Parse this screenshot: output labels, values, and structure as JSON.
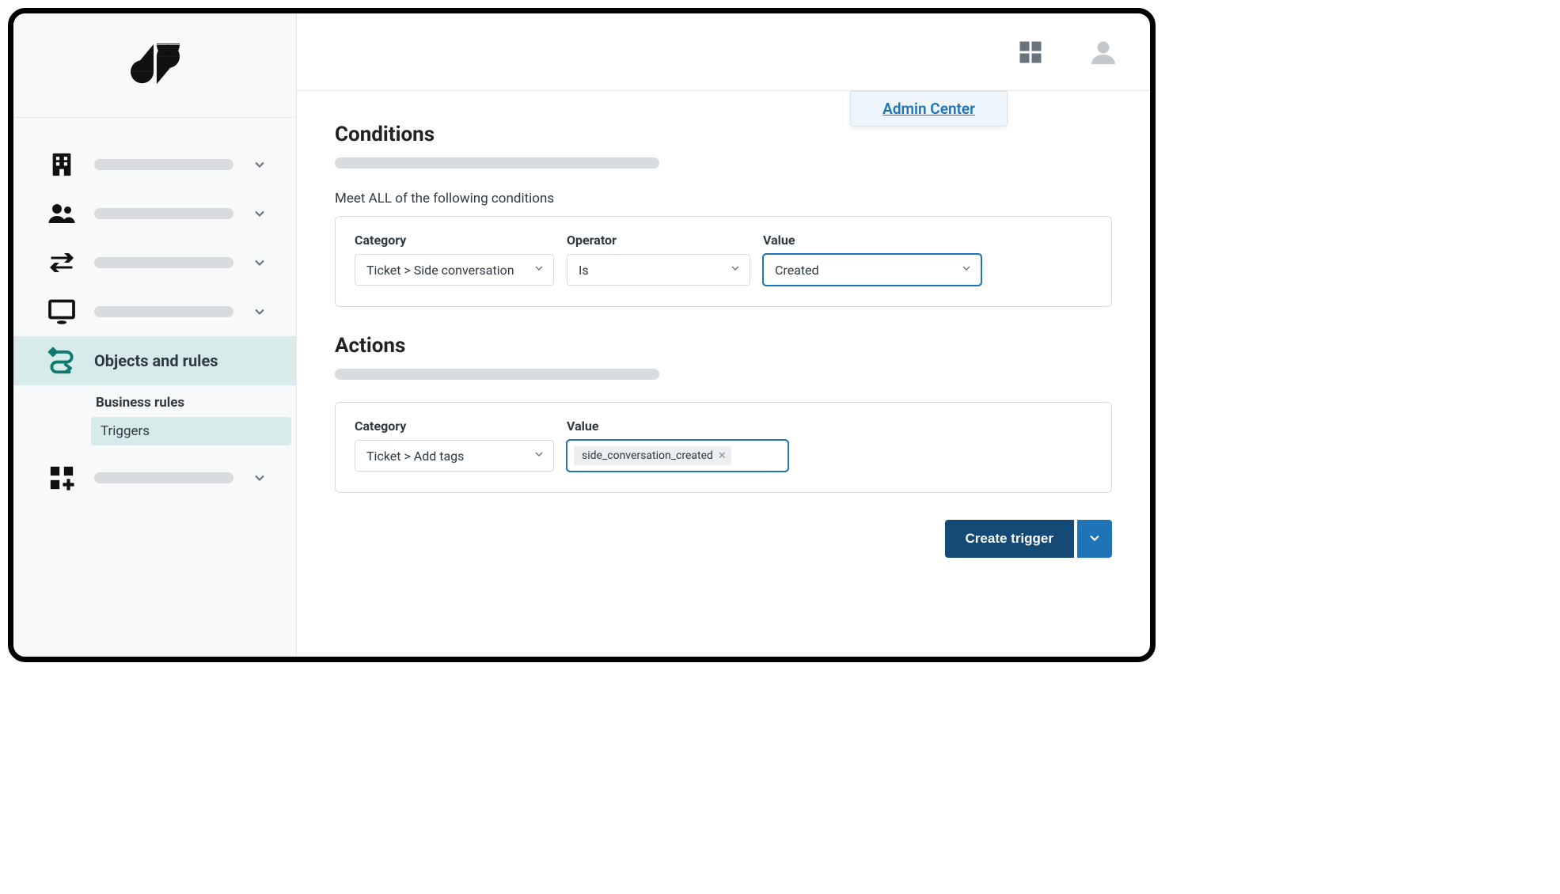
{
  "header": {
    "admin_center_label": "Admin Center"
  },
  "sidebar": {
    "items": [
      {
        "id": "account",
        "placeholder": true
      },
      {
        "id": "people",
        "placeholder": true
      },
      {
        "id": "channels",
        "placeholder": true
      },
      {
        "id": "workspaces",
        "placeholder": true
      },
      {
        "id": "objects-rules",
        "label": "Objects and rules",
        "active": true,
        "children": [
          {
            "id": "business-rules",
            "label": "Business rules"
          },
          {
            "id": "triggers",
            "label": "Triggers",
            "active": true
          }
        ]
      },
      {
        "id": "apps",
        "placeholder": true
      }
    ]
  },
  "conditions": {
    "title": "Conditions",
    "meet_all_label": "Meet ALL of the following conditions",
    "labels": {
      "category": "Category",
      "operator": "Operator",
      "value": "Value"
    },
    "row": {
      "category": "Ticket > Side conversation",
      "operator": "Is",
      "value": "Created"
    }
  },
  "actions": {
    "title": "Actions",
    "labels": {
      "category": "Category",
      "value": "Value"
    },
    "row": {
      "category": "Ticket > Add tags",
      "tag": "side_conversation_created"
    }
  },
  "buttons": {
    "create_trigger": "Create trigger"
  }
}
